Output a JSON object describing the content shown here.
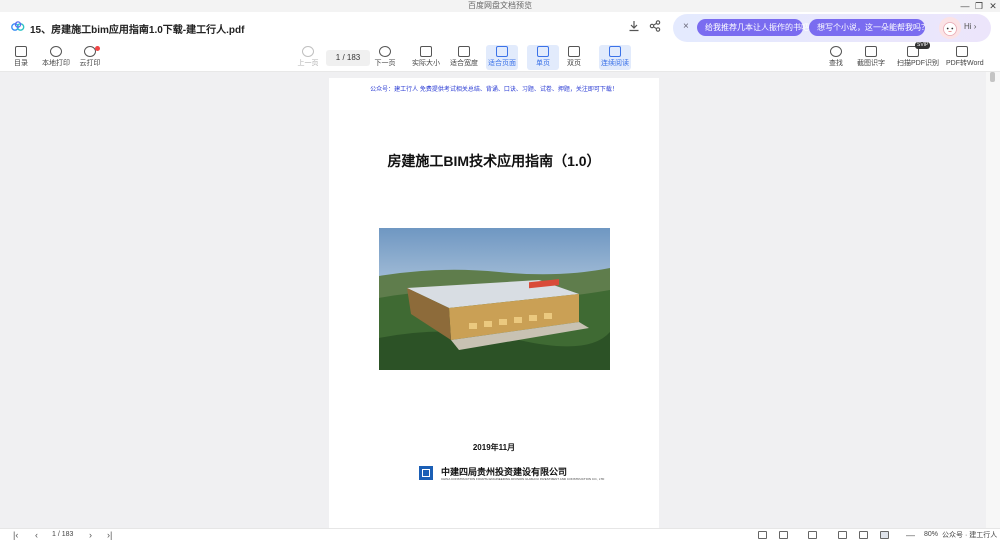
{
  "window": {
    "title": "百度网盘文档预览",
    "controls": [
      "—",
      "❐",
      "✕"
    ]
  },
  "file": {
    "name": "15、房建施工bim应用指南1.0下载-建工行人.pdf"
  },
  "ai": {
    "close": "×",
    "chip1": "给我推荐几本让人振作的书吧",
    "chip2": "想写个小说，这一朵能帮我吗？",
    "hi": "Hi ›"
  },
  "toolbar": {
    "left": [
      {
        "label": "目录"
      },
      {
        "label": "本地打印"
      },
      {
        "label": "云打印"
      }
    ],
    "prev_label": "上一页",
    "page_display": "1 / 183",
    "center": [
      {
        "label": "下一页"
      },
      {
        "label": "实际大小"
      },
      {
        "label": "适合宽度"
      },
      {
        "label": "适合页面"
      },
      {
        "label": "单页"
      },
      {
        "label": "双页"
      },
      {
        "label": "连续阅读"
      }
    ],
    "right": [
      {
        "label": "查找"
      },
      {
        "label": "截图识字"
      },
      {
        "label": "扫描PDF识别"
      },
      {
        "label": "PDF转Word"
      }
    ],
    "svip": "SVIP"
  },
  "document": {
    "notice": "公众号：建工行人 免费提供考试相关总结、背诵、口诀、习题、试卷、押题，关注即可下载！",
    "title": "房建施工BIM技术应用指南（1.0）",
    "date": "2019年11月",
    "company_cn": "中建四局贵州投资建设有限公司",
    "company_en": "CHINA CONSTRUCTION FOURTH ENGINEERING DIVISION GUIZHOU INVESTMENT AND CONSTRUCTION CO., LTD"
  },
  "statusbar": {
    "page": "1 / 183",
    "zoom": "80%",
    "minus": "—",
    "watermark": "公众号 · 建工行人"
  },
  "colors": {
    "accent": "#3b72e8",
    "ai_chip": "#7a6cf0",
    "notice_text": "#2a3bd4",
    "logo_blue": "#1b5fb5"
  }
}
